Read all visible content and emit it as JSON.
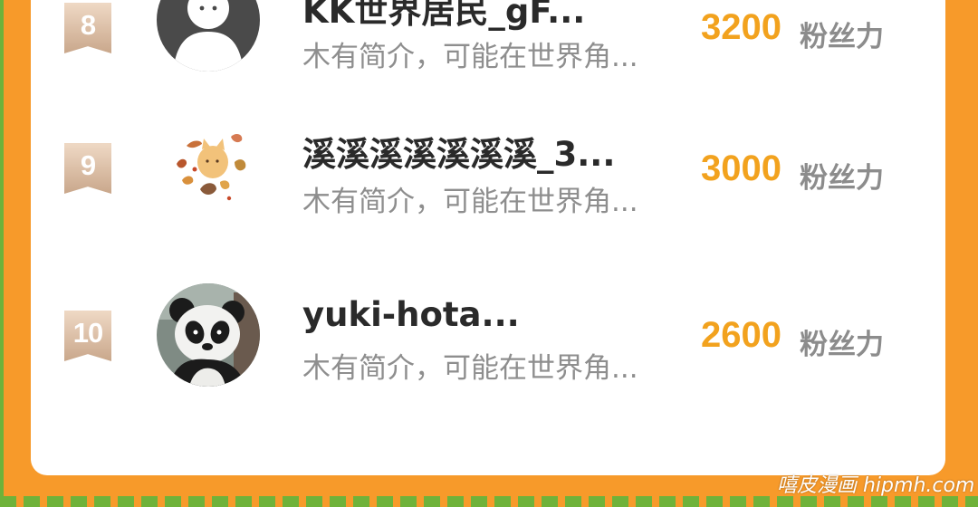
{
  "colors": {
    "background": "#F79A2A",
    "card": "#FFFFFF",
    "fans_value": "#F2A21E",
    "fans_unit": "#8C8C8C",
    "rank_badge": "#D8B89C"
  },
  "ranking": [
    {
      "rank": "8",
      "name": "KK世界居民_gF...",
      "bio": "木有简介，可能在世界角...",
      "fans": "3200",
      "unit": "粉丝力",
      "avatar": "default-ghost-avatar"
    },
    {
      "rank": "9",
      "name": "溪溪溪溪溪溪溪_3...",
      "bio": "木有简介，可能在世界角...",
      "fans": "3000",
      "unit": "粉丝力",
      "avatar": "autumn-leaves-cat-avatar"
    },
    {
      "rank": "10",
      "name": "yuki-hota...",
      "bio": "木有简介，可能在世界角...",
      "fans": "2600",
      "unit": "粉丝力",
      "avatar": "panda-photo-avatar"
    }
  ],
  "watermark": "嘻皮漫画 hipmh.com"
}
